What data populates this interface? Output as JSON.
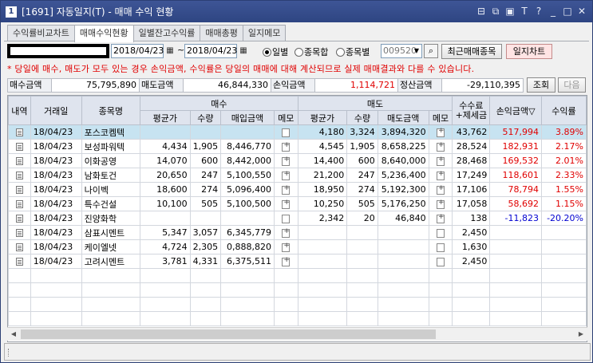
{
  "window": {
    "num_badge": "1",
    "title": "[1691] 자동일지(T) - 매매 수익 현황",
    "controls": [
      "⊟",
      "⧉",
      "▣",
      "T",
      "?",
      "_",
      "□",
      "✕"
    ]
  },
  "tabs": [
    {
      "label": "수익률비교차트",
      "active": false
    },
    {
      "label": "매매수익현황",
      "active": true
    },
    {
      "label": "일별잔고수익률",
      "active": false
    },
    {
      "label": "매매총평",
      "active": false
    },
    {
      "label": "일지메모",
      "active": false
    }
  ],
  "toolbar": {
    "date_from": "2018/04/23",
    "date_to": "2018/04/23",
    "tilde": "~",
    "radios": [
      {
        "label": "일별",
        "checked": true
      },
      {
        "label": "종목합",
        "checked": false
      },
      {
        "label": "종목별",
        "checked": false
      }
    ],
    "stock_code": "009520",
    "recent_button": "최근매매종목",
    "chart_button": "일지차트"
  },
  "notice": "* 당일에 매수, 매도가 모두 있는 경우 손익금액, 수익률은 당일의 매매에 대해 계산되므로 실제 매매결과와 다를 수 있습니다.",
  "summary": {
    "buy_label": "매수금액",
    "buy_value": "75,795,890",
    "sell_label": "매도금액",
    "sell_value": "46,844,330",
    "pl_label": "손익금액",
    "pl_value": "1,114,721",
    "settle_label": "정산금액",
    "settle_value": "-29,110,395",
    "query_button": "조회",
    "next_button": "다음"
  },
  "grid": {
    "headers": {
      "detail": "내역",
      "date": "거래일",
      "name": "종목명",
      "buy_group": "매수",
      "sell_group": "매도",
      "fee": "수수료",
      "fee2": "+제세금",
      "pl": "손익금액▽",
      "rate": "수익률",
      "avg_price": "평균가",
      "qty": "수량",
      "buy_amount": "매입금액",
      "memo": "메모",
      "sell_amount": "매도금액"
    },
    "rows": [
      {
        "date": "18/04/23",
        "name": "포스코켐텍",
        "b_avg": "",
        "b_qty": "",
        "b_amt": "",
        "b_memo": "blank",
        "s_avg": "4,180",
        "s_qty": "3,324",
        "s_amt": "3,894,320",
        "s_memo": "plus",
        "fee": "43,762",
        "pl": "517,994",
        "rate": "3.89%",
        "sign": "pos",
        "selected": true
      },
      {
        "date": "18/04/23",
        "name": "보성파워텍",
        "b_avg": "4,434",
        "b_qty": "1,905",
        "b_amt": "8,446,770",
        "b_memo": "plus",
        "s_avg": "4,545",
        "s_qty": "1,905",
        "s_amt": "8,658,225",
        "s_memo": "plus",
        "fee": "28,524",
        "pl": "182,931",
        "rate": "2.17%",
        "sign": "pos",
        "selected": false
      },
      {
        "date": "18/04/23",
        "name": "이화공영",
        "b_avg": "14,070",
        "b_qty": "600",
        "b_amt": "8,442,000",
        "b_memo": "plus",
        "s_avg": "14,400",
        "s_qty": "600",
        "s_amt": "8,640,000",
        "s_memo": "plus",
        "fee": "28,468",
        "pl": "169,532",
        "rate": "2.01%",
        "sign": "pos",
        "selected": false
      },
      {
        "date": "18/04/23",
        "name": "남화토건",
        "b_avg": "20,650",
        "b_qty": "247",
        "b_amt": "5,100,550",
        "b_memo": "plus",
        "s_avg": "21,200",
        "s_qty": "247",
        "s_amt": "5,236,400",
        "s_memo": "plus",
        "fee": "17,249",
        "pl": "118,601",
        "rate": "2.33%",
        "sign": "pos",
        "selected": false
      },
      {
        "date": "18/04/23",
        "name": "나이벡",
        "b_avg": "18,600",
        "b_qty": "274",
        "b_amt": "5,096,400",
        "b_memo": "plus",
        "s_avg": "18,950",
        "s_qty": "274",
        "s_amt": "5,192,300",
        "s_memo": "plus",
        "fee": "17,106",
        "pl": "78,794",
        "rate": "1.55%",
        "sign": "pos",
        "selected": false
      },
      {
        "date": "18/04/23",
        "name": "특수건설",
        "b_avg": "10,100",
        "b_qty": "505",
        "b_amt": "5,100,500",
        "b_memo": "plus",
        "s_avg": "10,250",
        "s_qty": "505",
        "s_amt": "5,176,250",
        "s_memo": "plus",
        "fee": "17,058",
        "pl": "58,692",
        "rate": "1.15%",
        "sign": "pos",
        "selected": false
      },
      {
        "date": "18/04/23",
        "name": "진양화학",
        "b_avg": "",
        "b_qty": "",
        "b_amt": "",
        "b_memo": "blank",
        "s_avg": "2,342",
        "s_qty": "20",
        "s_amt": "46,840",
        "s_memo": "plus",
        "fee": "138",
        "pl": "-11,823",
        "rate": "-20.20%",
        "sign": "neg",
        "selected": false
      },
      {
        "date": "18/04/23",
        "name": "삼표시멘트",
        "b_avg": "5,347",
        "b_qty": "3,057",
        "b_amt": "6,345,779",
        "b_memo": "plus",
        "s_avg": "",
        "s_qty": "",
        "s_amt": "",
        "s_memo": "blank",
        "fee": "2,450",
        "pl": "",
        "rate": "",
        "sign": "none",
        "selected": false
      },
      {
        "date": "18/04/23",
        "name": "케이엘넷",
        "b_avg": "4,724",
        "b_qty": "2,305",
        "b_amt": "0,888,820",
        "b_memo": "plus",
        "s_avg": "",
        "s_qty": "",
        "s_amt": "",
        "s_memo": "blank",
        "fee": "1,630",
        "pl": "",
        "rate": "",
        "sign": "none",
        "selected": false
      },
      {
        "date": "18/04/23",
        "name": "고려시멘트",
        "b_avg": "3,781",
        "b_qty": "4,331",
        "b_amt": "6,375,511",
        "b_memo": "plus",
        "s_avg": "",
        "s_qty": "",
        "s_amt": "",
        "s_memo": "blank",
        "fee": "2,450",
        "pl": "",
        "rate": "",
        "sign": "none",
        "selected": false
      }
    ]
  },
  "scroll": {
    "left_arrow": "◀",
    "right_arrow": "▶"
  }
}
